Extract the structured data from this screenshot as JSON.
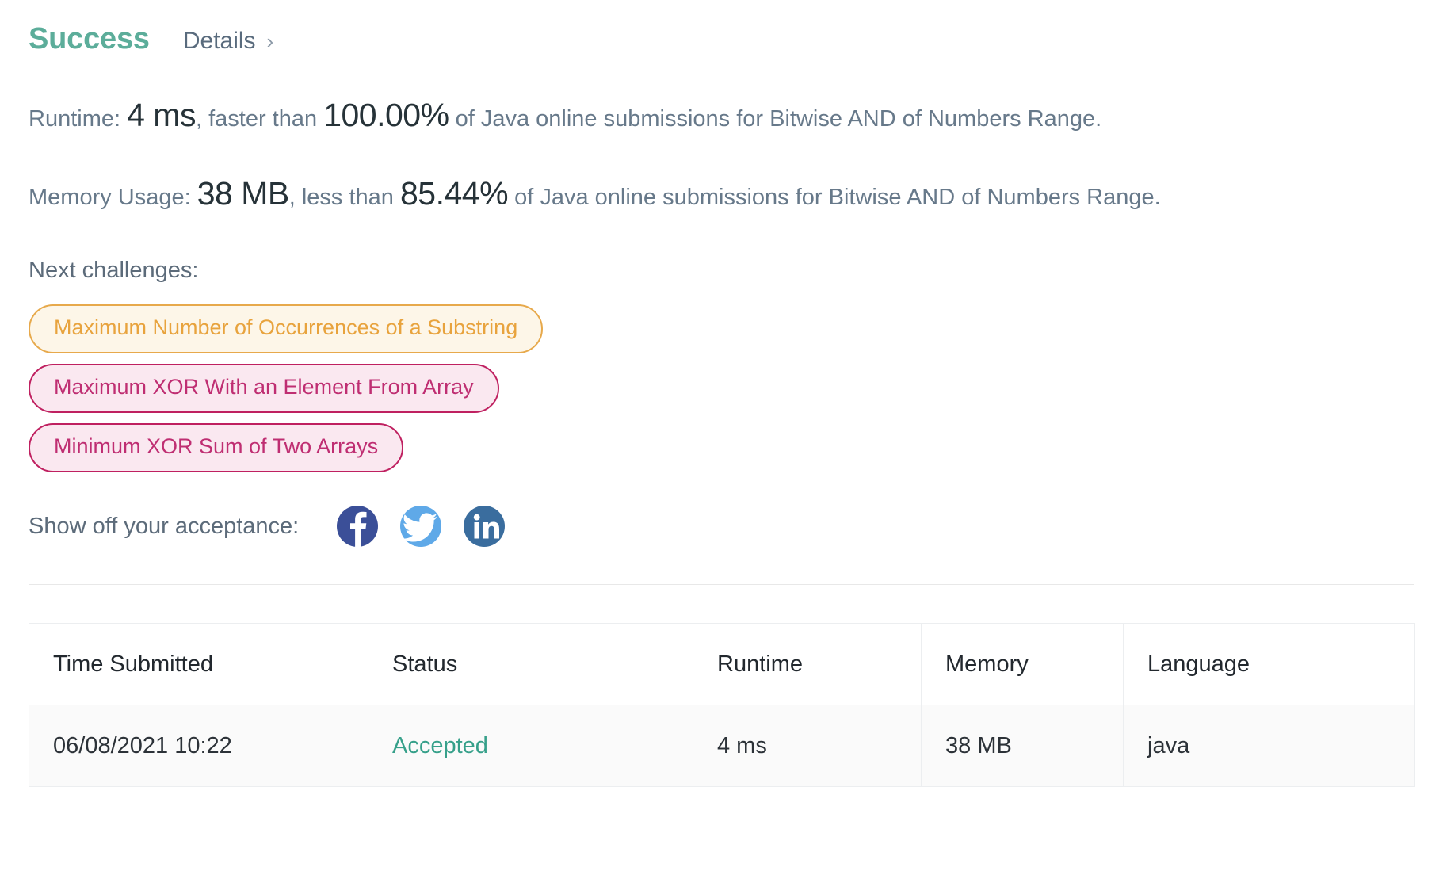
{
  "header": {
    "status": "Success",
    "details_label": "Details",
    "chevron": "›"
  },
  "stats": {
    "runtime": {
      "prefix": "Runtime:",
      "value": "4 ms",
      "middle": ", faster than",
      "percent": "100.00%",
      "suffix": "of Java online submissions for Bitwise AND of Numbers Range."
    },
    "memory": {
      "prefix": "Memory Usage:",
      "value": "38 MB",
      "middle": ", less than",
      "percent": "85.44%",
      "suffix": "of Java online submissions for Bitwise AND of Numbers Range."
    }
  },
  "next_challenges": {
    "label": "Next challenges:",
    "tags": [
      {
        "text": "Maximum Number of Occurrences of a Substring",
        "style": "amber"
      },
      {
        "text": "Maximum XOR With an Element From Array",
        "style": "pink"
      },
      {
        "text": "Minimum XOR Sum of Two Arrays",
        "style": "pink"
      }
    ]
  },
  "share": {
    "label": "Show off your acceptance:",
    "networks": [
      {
        "name": "facebook",
        "icon": "facebook-icon",
        "color": "#3b4f98"
      },
      {
        "name": "twitter",
        "icon": "twitter-icon",
        "color": "#5fa9e8"
      },
      {
        "name": "linkedin",
        "icon": "linkedin-icon",
        "color": "#3a6d9e"
      }
    ]
  },
  "submissions_table": {
    "columns": [
      "Time Submitted",
      "Status",
      "Runtime",
      "Memory",
      "Language"
    ],
    "rows": [
      {
        "time_submitted": "06/08/2021 10:22",
        "status": "Accepted",
        "runtime": "4 ms",
        "memory": "38 MB",
        "language": "java"
      }
    ]
  },
  "colors": {
    "success_green": "#5cad9a",
    "accepted_green": "#36a08a",
    "amber_text": "#e8a33d",
    "amber_bg": "#fdf6e8",
    "pink_text": "#bf2e72",
    "pink_bg": "#fae8f0",
    "body_text": "#67798a",
    "emphasis_text": "#263238"
  }
}
